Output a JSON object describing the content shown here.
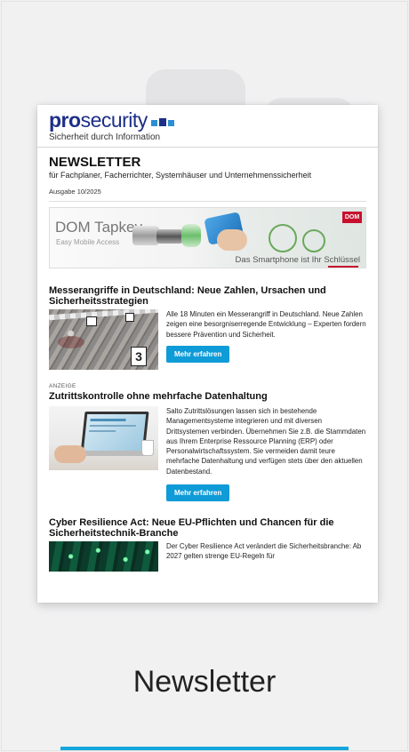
{
  "logo": {
    "part1": "pro",
    "part2": "security",
    "tagline": "Sicherheit durch Information"
  },
  "newsletter": {
    "title": "NEWSLETTER",
    "subtitle": "für Fachplaner, Facherrichter, Systemhäuser und Unternehmenssicherheit",
    "edition": "Ausgabe 10/2025"
  },
  "banner": {
    "title": "DOM Tapkey",
    "subtitle": "Easy Mobile Access",
    "brand": "DOM",
    "slogan": "Das Smartphone ist Ihr Schlüssel"
  },
  "articles": [
    {
      "title": "Messerangriffe in Deutschland: Neue Zahlen, Ursachen und Sicherheitsstrategien",
      "text": "Alle 18 Minuten ein Messerangriff in Deutschland. Neue Zahlen zeigen eine besorgniserregende Entwicklung – Experten fordern bessere Prävention und Sicherheit.",
      "button": "Mehr erfahren",
      "image_marker": "3"
    },
    {
      "label": "ANZEIGE",
      "title": "Zutrittskontrolle ohne mehrfache Datenhaltung",
      "text": "Salto Zutrittslösungen lassen sich in bestehende Managementsysteme integrieren und mit diversen Drittsystemen verbinden. Übernehmen Sie z.B. die Stammdaten aus Ihrem Enterprise Ressource Planning (ERP) oder Personalwirtschaftssystem. Sie vermeiden damit teure mehrfache Datenhaltung und verfügen stets über den aktuellen Datenbestand.",
      "button": "Mehr erfahren"
    },
    {
      "title": "Cyber Resilience Act: Neue EU-Pflichten und Chancen für die Sicherheitstechnik-Branche",
      "text": "Der Cyber Resilience Act verändert die Sicherheitsbranche: Ab 2027 gelten strenge EU-Regeln für"
    }
  ],
  "caption": "Newsletter",
  "colors": {
    "brand_blue": "#1d2f86",
    "button_blue": "#0f9bd7",
    "accent_bar": "#15a7dc",
    "dom_red": "#c8102e"
  }
}
